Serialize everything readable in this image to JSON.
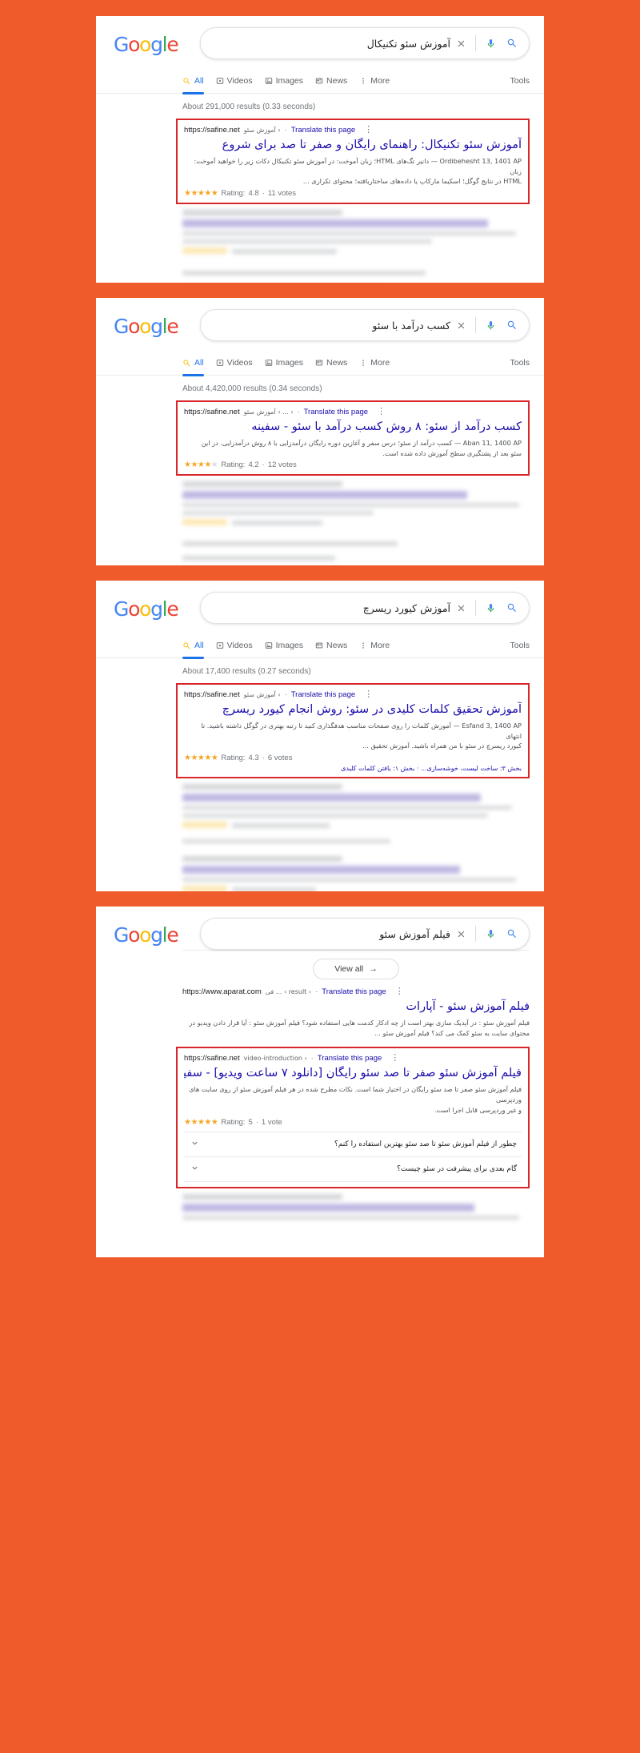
{
  "background_color": "#ef5b2b",
  "highlight_border_color": "#d8262b",
  "brand": {
    "logo": "Google",
    "letters": [
      "G",
      "o",
      "o",
      "g",
      "l",
      "e"
    ]
  },
  "search_icons": {
    "clear": "close-icon",
    "mic": "microphone-icon",
    "search": "search-icon"
  },
  "nav": {
    "tabs": [
      {
        "label": "All",
        "icon": "search-icon",
        "active": true
      },
      {
        "label": "Videos",
        "icon": "video-icon",
        "active": false
      },
      {
        "label": "Images",
        "icon": "image-icon",
        "active": false
      },
      {
        "label": "News",
        "icon": "news-icon",
        "active": false
      },
      {
        "label": "More",
        "icon": "more-kebab-icon",
        "active": false
      }
    ],
    "tools": "Tools"
  },
  "common": {
    "translate": "Translate this page",
    "separator": "·",
    "kebab": "⋮",
    "url": "https://safine.net"
  },
  "panels": [
    {
      "id": "panel-seo-technical",
      "query": "آموزش سئو تکنیکال",
      "stats": "About 291,000 results (0.33 seconds)",
      "highlighted_result": {
        "url": "https://safine.net",
        "breadcrumb": "› آموزش سئو",
        "translate": "Translate this page",
        "title": "آموزش سئو تکنیکال: راهنمای رایگان و صفر تا صد برای شروع",
        "snippet_line1": "Ordibehesht 13, 1401 AP — دانیر تگ‌های HTML؛ زبان آموخت: در آموزش سئو تکنیکال دکات زیر را خواهید آموخت: زبان",
        "snippet_line2": "HTML در نتایج گوگل؛ اسکیما مارکاپ یا داده‌های ساختاریافته؛ محتوای تکراری ...",
        "rating_label": "Rating:",
        "rating_value": "4.8",
        "votes": "11 votes",
        "stars_full": 5
      }
    },
    {
      "id": "panel-seo-income",
      "query": "کسب درآمد با سئو",
      "stats": "About 4,420,000 results (0.34 seconds)",
      "highlighted_result": {
        "url": "https://safine.net",
        "breadcrumb": "› ... › آموزش سئو",
        "translate": "Translate this page",
        "title": "کسب درآمد از سئو: ۸ روش کسب درآمد با سئو - سفینه",
        "snippet_line1": "Aban 11, 1400 AP — کسب درآمد از سئو؛ درس سفر و آغازین دوره رایگان درآمدزایی با ۸ روش درآمدزایی. در این",
        "snippet_line2": "سئو بعد از پشتگیری سطح آموزش داده شده است.",
        "rating_label": "Rating:",
        "rating_value": "4.2",
        "votes": "12 votes",
        "stars_full": 4
      }
    },
    {
      "id": "panel-keyword-research",
      "query": "آموزش کیورد ریسرچ",
      "stats": "About 17,400 results (0.27 seconds)",
      "highlighted_result": {
        "url": "https://safine.net",
        "breadcrumb": "› آموزش سئو",
        "translate": "Translate this page",
        "title": "آموزش تحقیق کلمات کلیدی در سئو: روش انجام کیورد ریسرچ",
        "snippet_line1": "Esfand 3, 1400 AP — آموزش کلمات را روی صفحات مناسب هدفگذاری کنید تا رتبه بهتری در گوگل داشته باشید. تا انتهای",
        "snippet_line2": "کیورد ریسرچ در سئو با من همراه باشید. آموزش تحقیق ...",
        "rating_label": "Rating:",
        "rating_value": "4.3",
        "votes": "6 votes",
        "sitelinks": "بخش ۳: ساخت لیست، خوشه‌سازی... · بخش ۱: یافتن کلمات کلیدی",
        "stars_full": 5
      }
    },
    {
      "id": "panel-seo-video",
      "query": "فیلم آموزش سئو",
      "view_all": "View all",
      "view_all_arrow": "→",
      "top_result": {
        "url": "https://www.aparat.com",
        "breadcrumb": "› result › ... فی",
        "translate": "Translate this page",
        "title": "فیلم آموزش سئو - آپارات",
        "snippet_line1": "فیلم آموزش سئو : در آپدیک سازی بهتر است از چه ادکار کدمت هایی استفاده شود؟ فیلم آموزش سئو : آیا قرار دادن ویدیو در",
        "snippet_line2": "محتوای سایت به سئو کمک می کند؟ فیلم آموزش سئو ..."
      },
      "highlighted_result": {
        "url": "https://safine.net",
        "breadcrumb": "› video-introduction",
        "translate": "Translate this page",
        "title": "فیلم آموزش سئو صفر تا صد سئو رایگان [دانلود ۷ ساعت ویدیو] - سفینه",
        "snippet_line1": "فیلم آموزش سئو صفر تا صد سئو رایگان در اختیار شما است. نکات مطرح شده در هر فیلم آموزش سئو از روی سایت های وردپرسی",
        "snippet_line2": "و غیر وردپرسی قابل اجرا است.",
        "rating_label": "Rating:",
        "rating_value": "5",
        "votes": "1 vote",
        "stars_full": 5,
        "faqs": [
          {
            "question": "چطور از فیلم آموزش سئو تا صد سئو بهترین استفاده را کنم؟",
            "chevron": "chevron-down-icon"
          },
          {
            "question": "گام بعدی برای پیشرفت در سئو چیست؟",
            "chevron": "chevron-down-icon"
          }
        ]
      }
    }
  ]
}
